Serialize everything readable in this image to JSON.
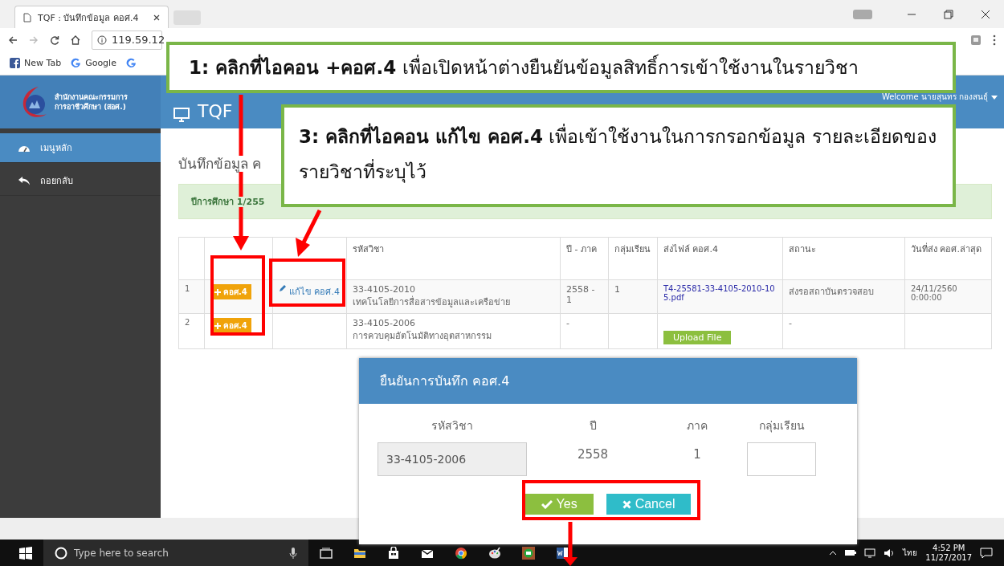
{
  "browser": {
    "tab_title": "TQF : บันทึกข้อมูล คอศ.4",
    "url": "119.59.12",
    "bookmarks": [
      {
        "label": "New Tab",
        "kind": "facebook"
      },
      {
        "label": "Google",
        "kind": "google"
      },
      {
        "kind": "google"
      }
    ]
  },
  "header": {
    "org_name": [
      "สำนักงานคณะกรรมการ",
      "การอาชีวศึกษา (สอศ.)"
    ],
    "app_title": "TQF",
    "welcome": "Welcome นายสุนทร กองสนธุ์"
  },
  "sidebar": {
    "items": [
      {
        "label": "เมนูหลัก",
        "kind": "home",
        "selected": true
      },
      {
        "label": "ถอยกลับ",
        "kind": "back",
        "selected": false
      }
    ]
  },
  "page": {
    "title": "บันทึกข้อมูล ค",
    "alert": "ปีการศึกษา 1/255"
  },
  "table": {
    "columns": [
      "",
      "",
      "",
      "รหัสวิชา",
      "ปี - ภาค",
      "กลุ่มเรียน",
      "ส่งไฟล์ คอศ.4",
      "สถานะ",
      "วันที่ส่ง คอศ.ล่าสุด"
    ],
    "rows": [
      {
        "no": "1",
        "add": "คอศ.4",
        "edit": "แก้ไข คอศ.4",
        "code": "33-4105-2010",
        "name": "เทคโนโลยีการสื่อสารข้อมูลและเครือข่าย",
        "term": "2558 - 1",
        "group": "1",
        "file": {
          "kind": "link",
          "label": "T4-25581-33-4105-2010-105.pdf"
        },
        "status": "ส่งรอสถาบันตรวจสอบ",
        "date": "24/11/2560 0:00:00"
      },
      {
        "no": "2",
        "add": "คอศ.4",
        "code": "33-4105-2006",
        "name": "การควบคุมอัตโนมัติทางอุตสาหกรรม",
        "term": "-",
        "file": {
          "kind": "upload",
          "label": "Upload File"
        },
        "status": "-"
      }
    ]
  },
  "modal": {
    "title": "ยืนยันการบันทึก คอศ.4",
    "fields": [
      {
        "label": "รหัสวิชา",
        "kind": "readonly",
        "value": "33-4105-2006"
      },
      {
        "label": "ปี",
        "kind": "text",
        "value": "2558"
      },
      {
        "label": "ภาค",
        "kind": "text",
        "value": "1"
      },
      {
        "label": "กลุ่มเรียน",
        "kind": "input"
      }
    ],
    "buttons": [
      {
        "label": "Yes",
        "kind": "yes"
      },
      {
        "label": "Cancel",
        "kind": "cancel"
      }
    ]
  },
  "callouts": [
    {
      "kind": "one",
      "text": "**1: คลิกที่ไอคอน +คอศ.4** เพื่อเปิดหน้าต่างยืนยันข้อมูลสิทธิ์การเข้าใช้งานในรายวิชา"
    },
    {
      "kind": "three",
      "text": "**3: คลิกที่ไอคอน แก้ไข คอศ.4** เพื่อเข้าใช้งานในการกรอกข้อมูล รายละเอียดของรายวิชาที่ระบุไว้"
    }
  ],
  "taskbar": {
    "search_placeholder": "Type here to search",
    "language": "ไทย",
    "time": "4:52 PM",
    "date": "11/27/2017"
  }
}
